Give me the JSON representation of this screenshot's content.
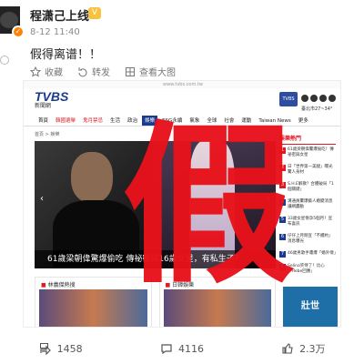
{
  "post": {
    "username": "程潇己上线",
    "vip_badge": "V",
    "timestamp": "8-12 11:40",
    "text": "假得离谱！！"
  },
  "toolbar": {
    "save_label": "收藏",
    "forward_label": "转发",
    "view_large_label": "查看大图"
  },
  "screenshot": {
    "url": "www.tvbs.com.tw",
    "logo": "TVBS",
    "logo_sub": "新聞網",
    "app_badge": "TVBS",
    "weather": "臺北市27~34°",
    "nav": [
      "首頁",
      "韓國選舉",
      "鬼月禁忌",
      "生活",
      "政治",
      "娛樂",
      "ESG永續",
      "氣象",
      "全球",
      "社會",
      "運動",
      "Taiwan News",
      "更多"
    ],
    "breadcrumb": "首頁 > 娛樂",
    "headline": "61歲梁朝偉驚爆偷吃 傳祕密與16歲女星，有私生子？",
    "sidebar": {
      "title": "娛樂熱門",
      "items": [
        {
          "num": "1",
          "text": "61歲梁朝偉驚爆偷吃！傳祕密與女星"
        },
        {
          "num": "2",
          "text": "日「世界第一美腿」曝光驚人身材"
        },
        {
          "num": "3",
          "text": "S.H.E解散？合體破局「1個關鍵」"
        },
        {
          "num": "4",
          "text": "溝通員驚爆藝人婚變消息讓網轟動"
        },
        {
          "num": "5",
          "text": "33歲女星懷孕5個月！宣布喜訊"
        },
        {
          "num": "6",
          "text": "仔仔上月剛宣「不續約」消息曝光"
        },
        {
          "num": "7",
          "text": "46歲男歌手遭爆「婚外情」"
        },
        {
          "num": "8",
          "text": "Selina笑侍了！比心「Hebe回應」"
        }
      ]
    },
    "card_left_title": "林義傑熱搜",
    "card_right_title": "日韓娛樂",
    "ad_text": "壯世",
    "watermark": "假"
  },
  "footer": {
    "share_count": "1458",
    "comment_count": "4116",
    "like_count": "2.3万"
  },
  "colors": {
    "accent_red": "#e8121b",
    "brand_blue": "#1a3b8f",
    "weibo_orange": "#ff8200"
  }
}
